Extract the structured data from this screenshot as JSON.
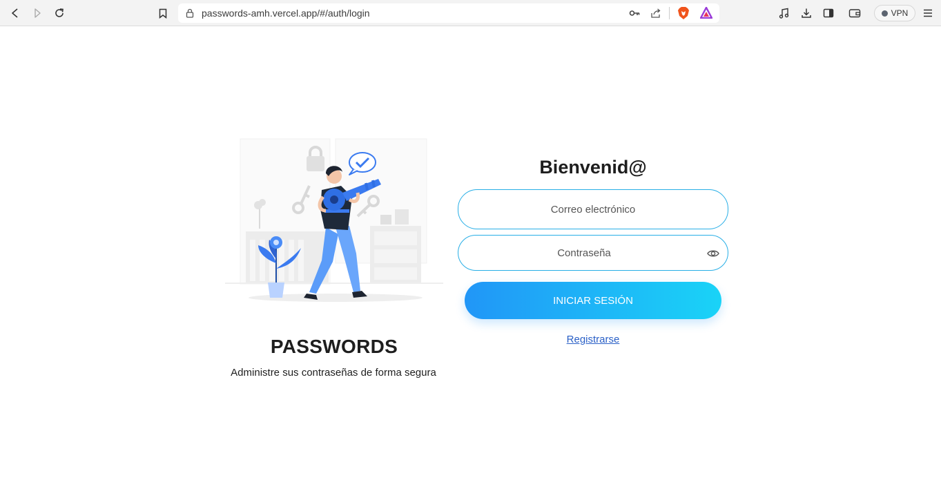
{
  "browser": {
    "url": "passwords-amh.vercel.app/#/auth/login",
    "vpn_label": "VPN"
  },
  "brand": {
    "title": "PASSWORDS",
    "subtitle": "Administre sus contraseñas de forma segura"
  },
  "login": {
    "heading": "Bienvenid@",
    "email_placeholder": "Correo electrónico",
    "password_placeholder": "Contraseña",
    "submit_label": "INICIAR SESIÓN",
    "register_label": "Registrarse"
  },
  "colors": {
    "accent_start": "#2196f7",
    "accent_end": "#1ad3f7",
    "field_border": "#27aee6",
    "link": "#2a60c7"
  }
}
